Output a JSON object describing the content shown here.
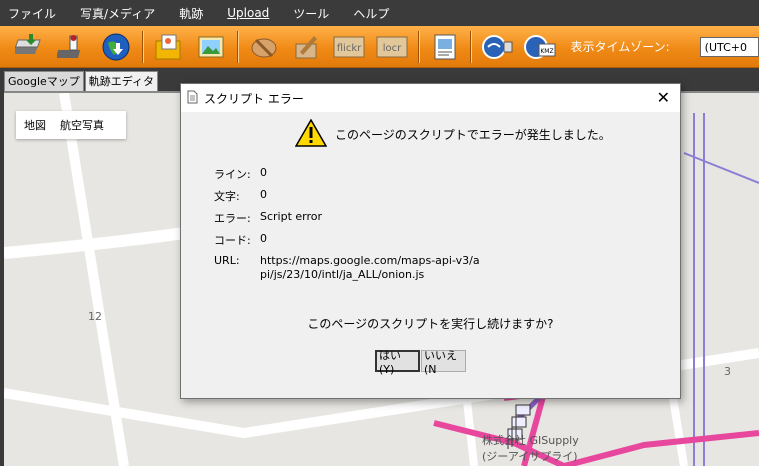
{
  "menu": [
    "ファイル",
    "写真/メディア",
    "軌跡",
    "Upload",
    "ツール",
    "ヘルプ"
  ],
  "toolbar": {
    "icons": [
      "import-icon",
      "gps-device-icon",
      "globe-download-icon",
      "folder-photo-icon",
      "photo-icon",
      "geotag-icon",
      "edit-icon",
      "flickr-icon",
      "locr-icon",
      "export-icon",
      "google-earth-icon",
      "kmz-icon"
    ],
    "flickr_label": "flickr",
    "locr_label": "locr",
    "kmz_label": "KMZ",
    "tz_label": "表示タイムゾーン:",
    "tz_value": "(UTC+0"
  },
  "tabs": [
    "Googleマップ",
    "軌跡エディタ"
  ],
  "map": {
    "type_map": "地図",
    "type_satellite": "航空写真",
    "num_left": "12",
    "num_right": "3",
    "poi_line1": "株式会社 GISupply",
    "poi_line2": "(ジーアイサプライ)"
  },
  "dialog": {
    "title": "スクリプト エラー",
    "heading": "このページのスクリプトでエラーが発生しました。",
    "rows": [
      {
        "key": "ライン:",
        "value": "0"
      },
      {
        "key": "文字:",
        "value": "0"
      },
      {
        "key": "エラー:",
        "value": "Script error"
      },
      {
        "key": "コード:",
        "value": "0"
      },
      {
        "key": "URL:",
        "value": "https://maps.google.com/maps-api-v3/api/js/23/10/intl/ja_ALL/onion.js"
      }
    ],
    "question": "このページのスクリプトを実行し続けますか?",
    "yes": "はい(Y)",
    "no": "いいえ(N"
  },
  "colors": {
    "toolbar": "#f08a16",
    "route": "#e8479e"
  }
}
